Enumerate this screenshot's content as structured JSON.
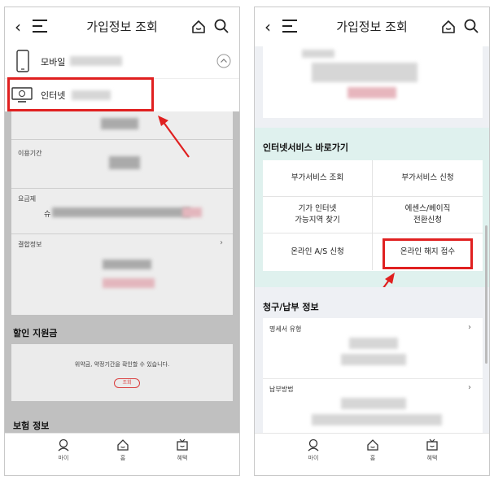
{
  "left_screen": {
    "header": {
      "title": "가입정보 조회"
    },
    "lines": [
      {
        "label": "모바일"
      },
      {
        "label": "인터넷"
      }
    ],
    "fields": {
      "period_label": "이용기간",
      "plan_label": "요금제",
      "plan_value_prefix": "슈",
      "bundle_label": "결합정보"
    },
    "discount": {
      "title": "할인 지원금",
      "message": "위약금, 약정기간을 확인할 수 있습니다.",
      "button": "조회"
    },
    "insurance": {
      "title": "보험 정보"
    },
    "nav": [
      "마이",
      "홈",
      "혜택"
    ]
  },
  "right_screen": {
    "header": {
      "title": "가입정보 조회"
    },
    "shortcut": {
      "title": "인터넷서비스 바로가기",
      "items": [
        "부가서비스 조회",
        "부가서비스 신청",
        "기가 인터넷\n가능지역 찾기",
        "에센스/베이직\n전환신청",
        "온라인 A/S 신청",
        "온라인 해지 접수"
      ]
    },
    "billing": {
      "title": "청구/납부 정보",
      "invoice_label": "명세서 유형",
      "payment_label": "납부방법"
    },
    "nav": [
      "마이",
      "홈",
      "혜택"
    ]
  },
  "colors": {
    "highlight": "#e02020",
    "mint": "#dff1ee",
    "dim": "#8c8c8c"
  }
}
